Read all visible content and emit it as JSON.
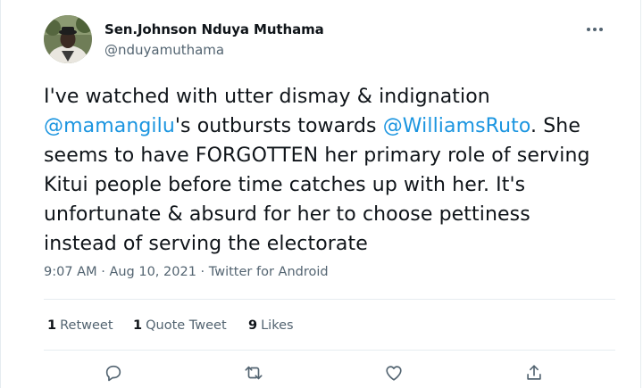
{
  "tweet": {
    "author": {
      "name": "Sen.Johnson Nduya Muthama",
      "handle": "@nduyamuthama"
    },
    "text": {
      "l1": "I've watched with utter dismay & indignation",
      "m1": "@mamangilu",
      "l2b": "'s outbursts towards ",
      "m2": "@WilliamsRuto",
      "l2d": ". She",
      "l3": "seems to have FORGOTTEN her primary role of serving",
      "l4": "Kitui people before time catches up with her. It's",
      "l5": "unfortunate & absurd for her to choose pettiness",
      "l6": "instead of serving the electorate"
    },
    "meta": {
      "time": "9:07 AM",
      "sep1": " · ",
      "date": "Aug 10, 2021",
      "sep2": " · ",
      "source": "Twitter for Android"
    },
    "stats": {
      "retweets": {
        "count": "1",
        "label": "Retweet"
      },
      "quotes": {
        "count": "1",
        "label": "Quote Tweet"
      },
      "likes": {
        "count": "9",
        "label": "Likes"
      }
    },
    "actions": [
      "reply-icon",
      "retweet-icon",
      "like-icon",
      "share-icon"
    ]
  },
  "colors": {
    "link": "#1b95e0",
    "secondary": "#536471",
    "divider": "#e6ecf0"
  }
}
